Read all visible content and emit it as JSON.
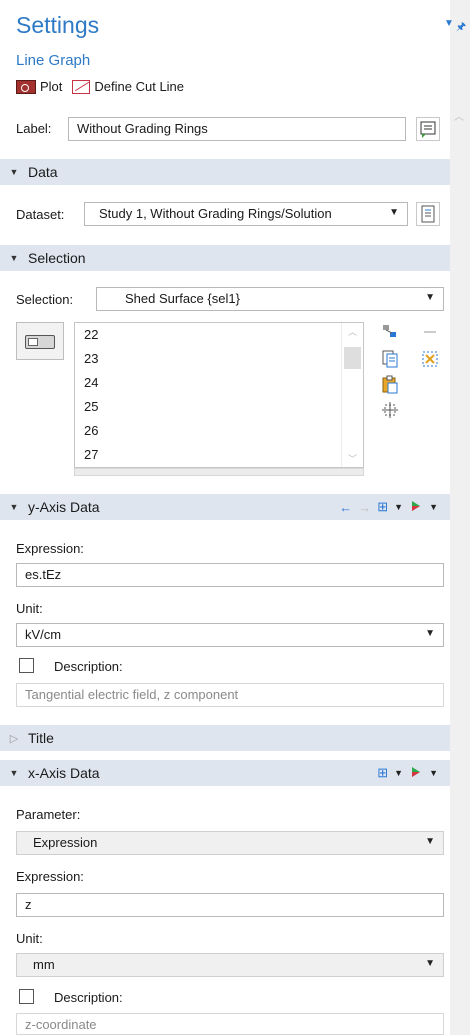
{
  "header": {
    "title": "Settings",
    "subtitle": "Line Graph",
    "plot_label": "Plot",
    "define_cut_line_label": "Define Cut Line"
  },
  "label_field": {
    "label": "Label:",
    "value": "Without Grading Rings"
  },
  "data_section": {
    "title": "Data",
    "dataset_label": "Dataset:",
    "dataset_value": "Study 1, Without Grading Rings/Solution"
  },
  "selection_section": {
    "title": "Selection",
    "selection_label": "Selection:",
    "selection_value": "Shed Surface {sel1}",
    "items": [
      "22",
      "23",
      "24",
      "25",
      "26",
      "27"
    ]
  },
  "y_axis_section": {
    "title": "y-Axis Data",
    "expression_label": "Expression:",
    "expression_value": "es.tEz",
    "unit_label": "Unit:",
    "unit_value": "kV/cm",
    "description_label": "Description:",
    "description_value": "Tangential electric field, z component"
  },
  "title_section": {
    "title": "Title"
  },
  "x_axis_section": {
    "title": "x-Axis Data",
    "parameter_label": "Parameter:",
    "parameter_value": "Expression",
    "expression_label": "Expression:",
    "expression_value": "z",
    "unit_label": "Unit:",
    "unit_value": "mm",
    "description_label": "Description:",
    "description_value": "z-coordinate"
  },
  "icons": {
    "toggle": "toggle-icon",
    "plot": "plot-icon",
    "cut_line": "cut-line-icon"
  },
  "colors": {
    "accent": "#2e7ac7",
    "section_bg": "#dfe5ef"
  }
}
